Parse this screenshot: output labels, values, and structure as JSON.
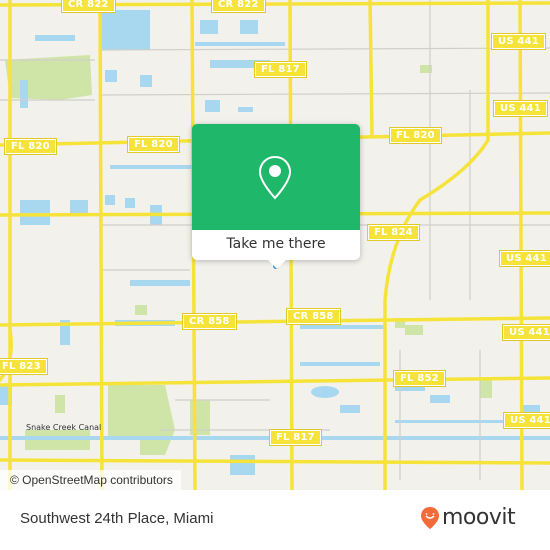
{
  "map": {
    "road_labels": [
      {
        "id": "cr822-a",
        "text": "CR 822"
      },
      {
        "id": "cr822-b",
        "text": "CR 822"
      },
      {
        "id": "fl817-top",
        "text": "FL 817"
      },
      {
        "id": "us441-1",
        "text": "US 441"
      },
      {
        "id": "fl820-left",
        "text": "FL 820"
      },
      {
        "id": "fl820-mid",
        "text": "FL 820"
      },
      {
        "id": "fl820-right",
        "text": "FL 820"
      },
      {
        "id": "us441-2",
        "text": "US 441"
      },
      {
        "id": "fl824",
        "text": "FL 824"
      },
      {
        "id": "us441-3",
        "text": "US 441"
      },
      {
        "id": "cr858-left",
        "text": "CR 858"
      },
      {
        "id": "cr858-right",
        "text": "CR 858"
      },
      {
        "id": "us441-4",
        "text": "US 441"
      },
      {
        "id": "fl823",
        "text": "FL 823"
      },
      {
        "id": "fl852",
        "text": "FL 852"
      },
      {
        "id": "us441-5",
        "text": "US 441"
      },
      {
        "id": "fl817-bottom",
        "text": "FL 817"
      }
    ],
    "canal_label": "Snake Creek Canal",
    "attribution": "© OpenStreetMap contributors",
    "colors": {
      "land": "#f2f1ec",
      "road": "#f6e33a",
      "water": "#a8d8f0",
      "park": "#cfe5a8",
      "minor_road": "#cfcfcf"
    }
  },
  "popup": {
    "button_label": "Take me there",
    "icon": "map-pin-icon",
    "color": "#1fb86a"
  },
  "footer": {
    "address": "Southwest 24th Place, Miami",
    "brand": "moovit",
    "brand_color": "#f26b3a"
  }
}
